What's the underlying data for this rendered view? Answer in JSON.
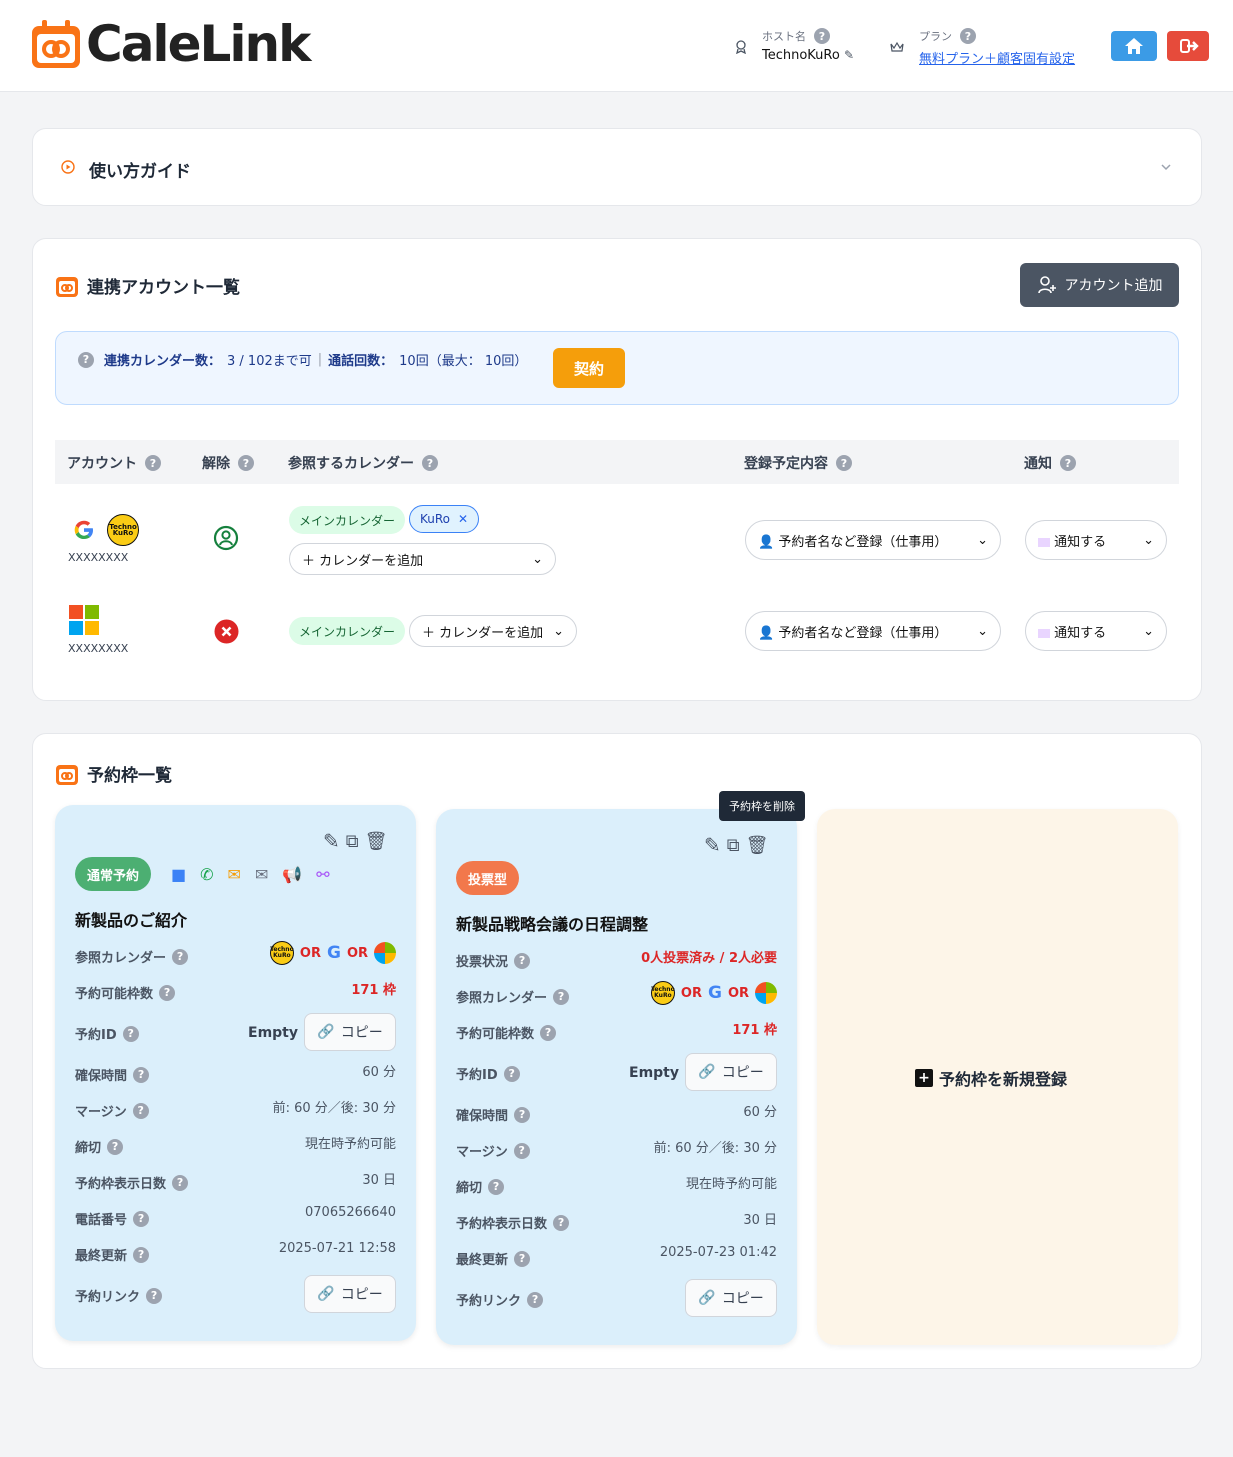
{
  "header": {
    "logo_text": "CaleLink",
    "host_label": "ホスト名",
    "host_value": "TechnoKuRo",
    "plan_label": "プラン",
    "plan_value": "無料プラン＋顧客固有設定"
  },
  "guide": {
    "title": "使い方ガイド"
  },
  "accounts_section": {
    "title": "連携アカウント一覧",
    "add_button": "アカウント追加",
    "info": {
      "calendar_count_label": "連携カレンダー数：",
      "calendar_count_value": "3 / 102まで可",
      "separator": "|",
      "call_count_label": "通話回数：",
      "call_count_value": "10回（最大： 10回）",
      "contract_button": "契約"
    },
    "columns": [
      "アカウント",
      "解除",
      "参照するカレンダー",
      "登録予定内容",
      "通知"
    ],
    "rows": [
      {
        "provider": "google",
        "name": "XXXXXXXX",
        "calendars": [
          "メインカレンダー",
          "KuRo"
        ],
        "add_calendar": "＋ カレンダーを追加",
        "register": "予約者名など登録（仕事用）",
        "notify": "通知する"
      },
      {
        "provider": "microsoft",
        "name": "XXXXXXXX",
        "calendars": [
          "メインカレンダー"
        ],
        "add_calendar": "＋ カレンダーを追加",
        "register": "予約者名など登録（仕事用）",
        "notify": "通知する"
      }
    ]
  },
  "slots_section": {
    "title": "予約枠一覧",
    "tooltip": "予約枠を削除",
    "new_slot_label": "予約枠を新規登録",
    "or": "OR",
    "copy": "コピー",
    "empty": "Empty",
    "mini_logo": "Techno KuRo",
    "slot1": {
      "badge": "通常予約",
      "title": "新製品のご紹介",
      "labels": [
        "参照カレンダー",
        "予約可能枠数",
        "予約ID",
        "確保時間",
        "マージン",
        "締切",
        "予約枠表示日数",
        "電話番号",
        "最終更新",
        "予約リンク"
      ],
      "available": "171 枠",
      "duration": "60 分",
      "margin": "前: 60 分／後: 30 分",
      "deadline": "現在時予約可能",
      "display_days": "30 日",
      "phone": "07065266640",
      "updated": "2025-07-21 12:58"
    },
    "slot2": {
      "badge": "投票型",
      "title": "新製品戦略会議の日程調整",
      "labels": [
        "投票状況",
        "参照カレンダー",
        "予約可能枠数",
        "予約ID",
        "確保時間",
        "マージン",
        "締切",
        "予約枠表示日数",
        "最終更新",
        "予約リンク"
      ],
      "vote_status": "0人投票済み / 2人必要",
      "available": "171 枠",
      "duration": "60 分",
      "margin": "前: 60 分／後: 30 分",
      "deadline": "現在時予約可能",
      "display_days": "30 日",
      "updated": "2025-07-23 01:42"
    }
  },
  "colors": {
    "accent_orange": "#f97316",
    "home_blue": "#3b9be6",
    "logout_red": "#e64b3b",
    "contract_orange": "#f59e0b",
    "normal_badge": "#4caf72",
    "vote_badge": "#f2784b"
  }
}
